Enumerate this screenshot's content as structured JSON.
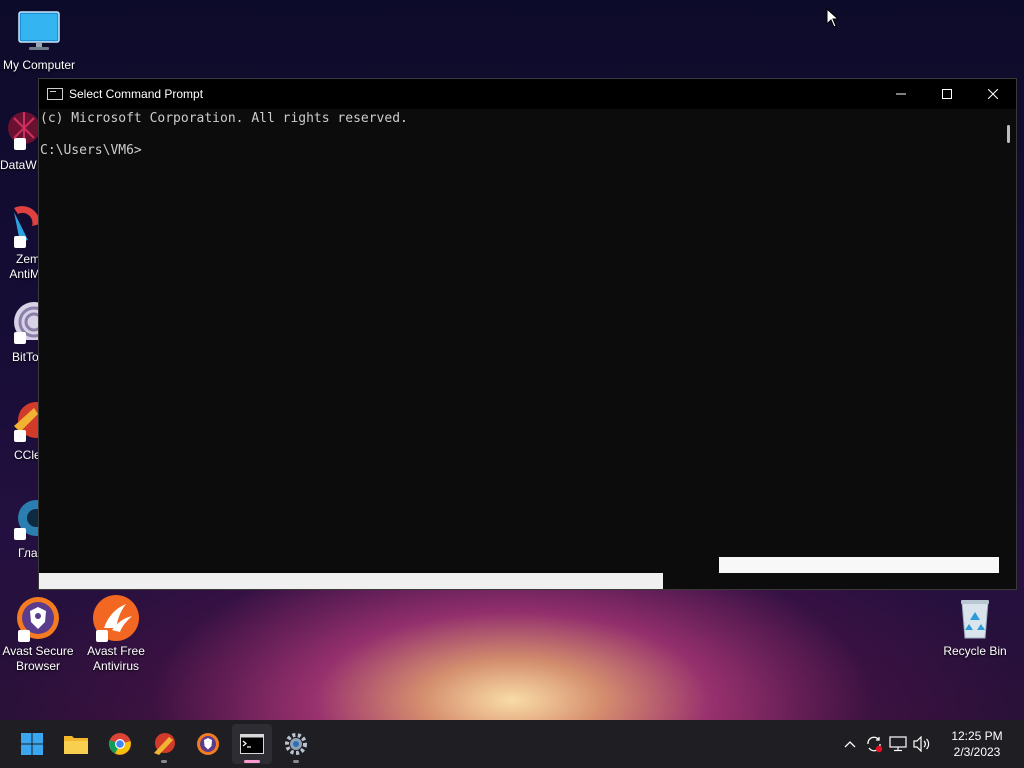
{
  "desktop": {
    "icons": [
      {
        "label": "My Computer",
        "icon": "monitor-icon"
      },
      {
        "label": "Avast Secure Browser",
        "icon": "avast-secure-browser-icon"
      },
      {
        "label": "Avast Free Antivirus",
        "icon": "avast-antivirus-icon"
      },
      {
        "label": "Recycle Bin",
        "icon": "recycle-bin-icon"
      }
    ],
    "partial_icons": [
      {
        "label": "DataW",
        "icon": "datawiper-icon"
      },
      {
        "label": "Zem AntiM",
        "icon": "zemana-icon"
      },
      {
        "label": "BitTo",
        "icon": "bittorrent-icon"
      },
      {
        "label": "CCle",
        "icon": "ccleaner-icon"
      },
      {
        "label": "Глa",
        "icon": "app-icon"
      }
    ]
  },
  "window": {
    "title": "Select Command Prompt",
    "console_lines": [
      "(c) Microsoft Corporation. All rights reserved.",
      "",
      "C:\\Users\\VM6>"
    ]
  },
  "taskbar": {
    "apps": [
      "start-icon",
      "file-explorer-icon",
      "chrome-icon",
      "ccleaner-icon",
      "avast-browser-icon",
      "command-prompt-icon",
      "settings-icon"
    ],
    "active_app": "command-prompt-icon",
    "tray_icons": [
      "chevron-up-icon",
      "sync-icon",
      "network-icon",
      "volume-icon"
    ],
    "time": "12:25 PM",
    "date": "2/3/2023"
  },
  "colors": {
    "console_bg": "#0c0c0c",
    "console_text": "#cccccc",
    "taskbar_bg": "#1f1f23"
  }
}
